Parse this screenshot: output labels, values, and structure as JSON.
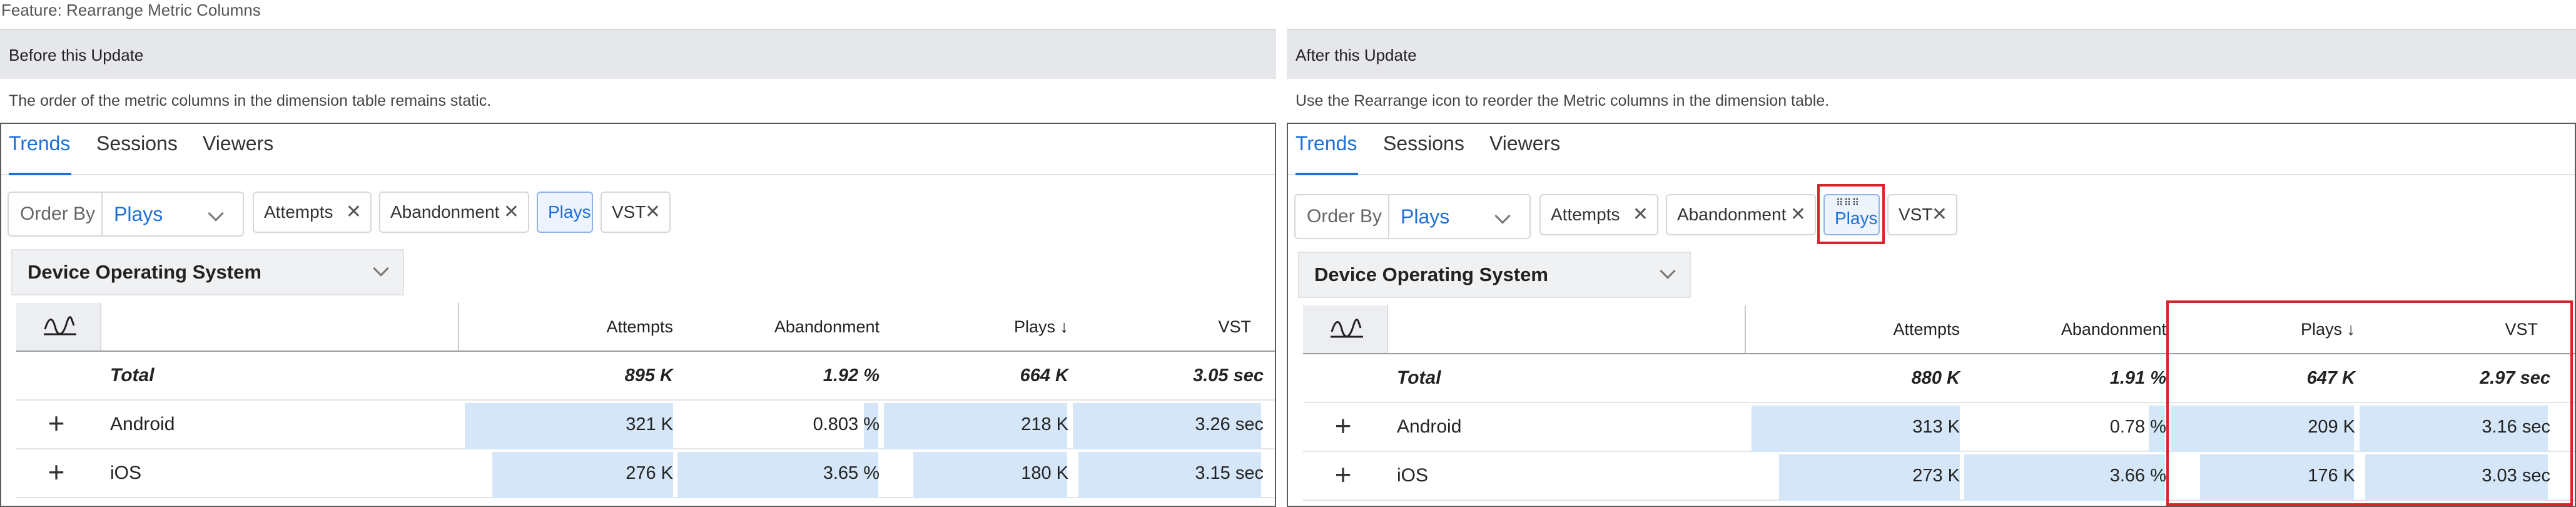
{
  "feature_title": "Feature: Rearrange Metric Columns",
  "before": {
    "header": "Before this Update",
    "description": "The order of the metric columns in the dimension table remains static.",
    "tabs": [
      "Trends",
      "Sessions",
      "Viewers"
    ],
    "order_by_label": "Order By",
    "order_by_value": "Plays",
    "chips": [
      "Attempts",
      "Abandonment",
      "Plays",
      "VST"
    ],
    "dimension": "Device Operating System",
    "columns": [
      "Attempts",
      "Abandonment",
      "Plays ↓",
      "VST"
    ],
    "total_label": "Total",
    "total": [
      "895 K",
      "1.92 %",
      "664 K",
      "3.05 sec"
    ],
    "rows": [
      {
        "label": "Android",
        "values": [
          "321 K",
          "0.803 %",
          "218 K",
          "3.26 sec"
        ]
      },
      {
        "label": "iOS",
        "values": [
          "276 K",
          "3.65 %",
          "180 K",
          "3.15 sec"
        ]
      }
    ]
  },
  "after": {
    "header": "After this Update",
    "description": "Use the Rearrange icon to reorder the Metric columns in the dimension table.",
    "tabs": [
      "Trends",
      "Sessions",
      "Viewers"
    ],
    "order_by_label": "Order By",
    "order_by_value": "Plays",
    "chips": [
      "Attempts",
      "Abandonment",
      "Plays",
      "VST"
    ],
    "drag_handle": "⠿⠿⠿",
    "dimension": "Device Operating System",
    "columns": [
      "Attempts",
      "Abandonment",
      "Plays ↓",
      "VST"
    ],
    "total_label": "Total",
    "total": [
      "880 K",
      "1.91 %",
      "647 K",
      "2.97 sec"
    ],
    "rows": [
      {
        "label": "Android",
        "values": [
          "313 K",
          "0.78 %",
          "209 K",
          "3.16 sec"
        ]
      },
      {
        "label": "iOS",
        "values": [
          "273 K",
          "3.66 %",
          "176 K",
          "3.03 sec"
        ]
      }
    ]
  },
  "colors": {
    "accent": "#1f6fd9",
    "bar": "#d4e6f8",
    "highlight": "#d8232a",
    "header_bg": "#e6e7ea"
  },
  "icons": {
    "trend": "trend-line-icon",
    "expand": "plus-icon",
    "remove": "close-icon",
    "dropdown": "chevron-down-icon",
    "rearrange": "drag-handle-icon"
  },
  "bar_fractions": {
    "before": [
      [
        0.99,
        0.07,
        0.99,
        0.99
      ],
      [
        0.86,
        0.99,
        0.83,
        0.96
      ]
    ],
    "after": [
      [
        0.99,
        0.08,
        0.99,
        0.99
      ],
      [
        0.86,
        0.99,
        0.83,
        0.96
      ]
    ]
  }
}
